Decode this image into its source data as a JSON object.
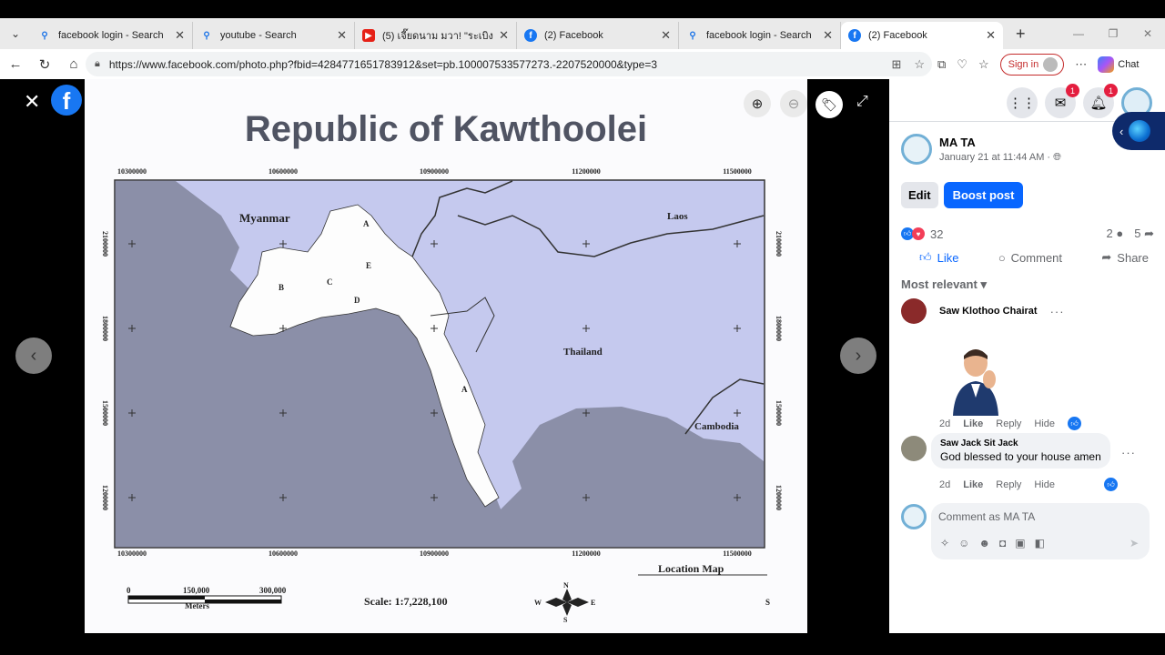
{
  "browser": {
    "tabs": [
      {
        "title": "facebook login - Search",
        "icon": "search-icon"
      },
      {
        "title": "youtube - Search",
        "icon": "search-icon"
      },
      {
        "title": "(5) เจี๊ยดนาม มวา! \"ระเบิงเศรษฐกิ",
        "icon": "youtube-icon"
      },
      {
        "title": "(2) Facebook",
        "icon": "facebook-icon"
      },
      {
        "title": "facebook login - Search",
        "icon": "search-icon"
      },
      {
        "title": "(2) Facebook",
        "icon": "facebook-icon",
        "active": true
      }
    ],
    "url": "https://www.facebook.com/photo.php?fbid=4284771651783912&set=pb.100007533577273.-2207520000&type=3",
    "signin_label": "Sign in",
    "chat_label": "Chat"
  },
  "slide": {
    "title": "Republic of Kawthoolei",
    "top_ticks": [
      "10300000",
      "10600000",
      "10900000",
      "11200000",
      "11500000"
    ],
    "bottom_ticks": [
      "10300000",
      "10600000",
      "10900000",
      "11200000",
      "11500000"
    ],
    "left_ticks": [
      "2100000",
      "1800000",
      "1500000",
      "1200000"
    ],
    "right_ticks": [
      "2100000",
      "1800000",
      "1500000",
      "1200000"
    ],
    "labels": {
      "myanmar": "Myanmar",
      "laos": "Laos",
      "thailand": "Thailand",
      "cambodia": "Cambodia",
      "region_a": "A",
      "region_a2": "A",
      "region_b": "B",
      "region_c": "C",
      "region_d": "D",
      "region_e": "E"
    },
    "location_map": "Location Map",
    "scalebar": {
      "t0": "0",
      "t1": "150,000",
      "t2": "300,000",
      "unit": "Meters"
    },
    "scale_text": "Scale: 1:7,228,100",
    "compass": {
      "n": "N",
      "s": "S",
      "e": "E",
      "w": "W"
    },
    "corner_mark": "S"
  },
  "panel": {
    "messenger_badge": "1",
    "notif_badge": "1",
    "author_name": "MA TA",
    "post_date": "January 21 at 11:44 AM ·",
    "edit_label": "Edit",
    "boost_label": "Boost post",
    "reactions_count": "32",
    "comments_count": "2",
    "shares_count": "5",
    "like_label": "Like",
    "comment_label": "Comment",
    "share_label": "Share",
    "most_relevant": "Most relevant",
    "comments": [
      {
        "name": "Saw Klothoo Chairat",
        "text": "",
        "age": "2d",
        "like": "Like",
        "reply": "Reply",
        "hide": "Hide"
      },
      {
        "name": "Saw Jack Sit Jack",
        "text": "God blessed to your house amen",
        "age": "2d",
        "like": "Like",
        "reply": "Reply",
        "hide": "Hide"
      }
    ],
    "composer_placeholder": "Comment as MA TA"
  },
  "colors": {
    "facebook_blue": "#1877f2",
    "boost_blue": "#0866ff",
    "map_land": "#8b8fa8",
    "map_thailand": "#c5c9ee"
  }
}
